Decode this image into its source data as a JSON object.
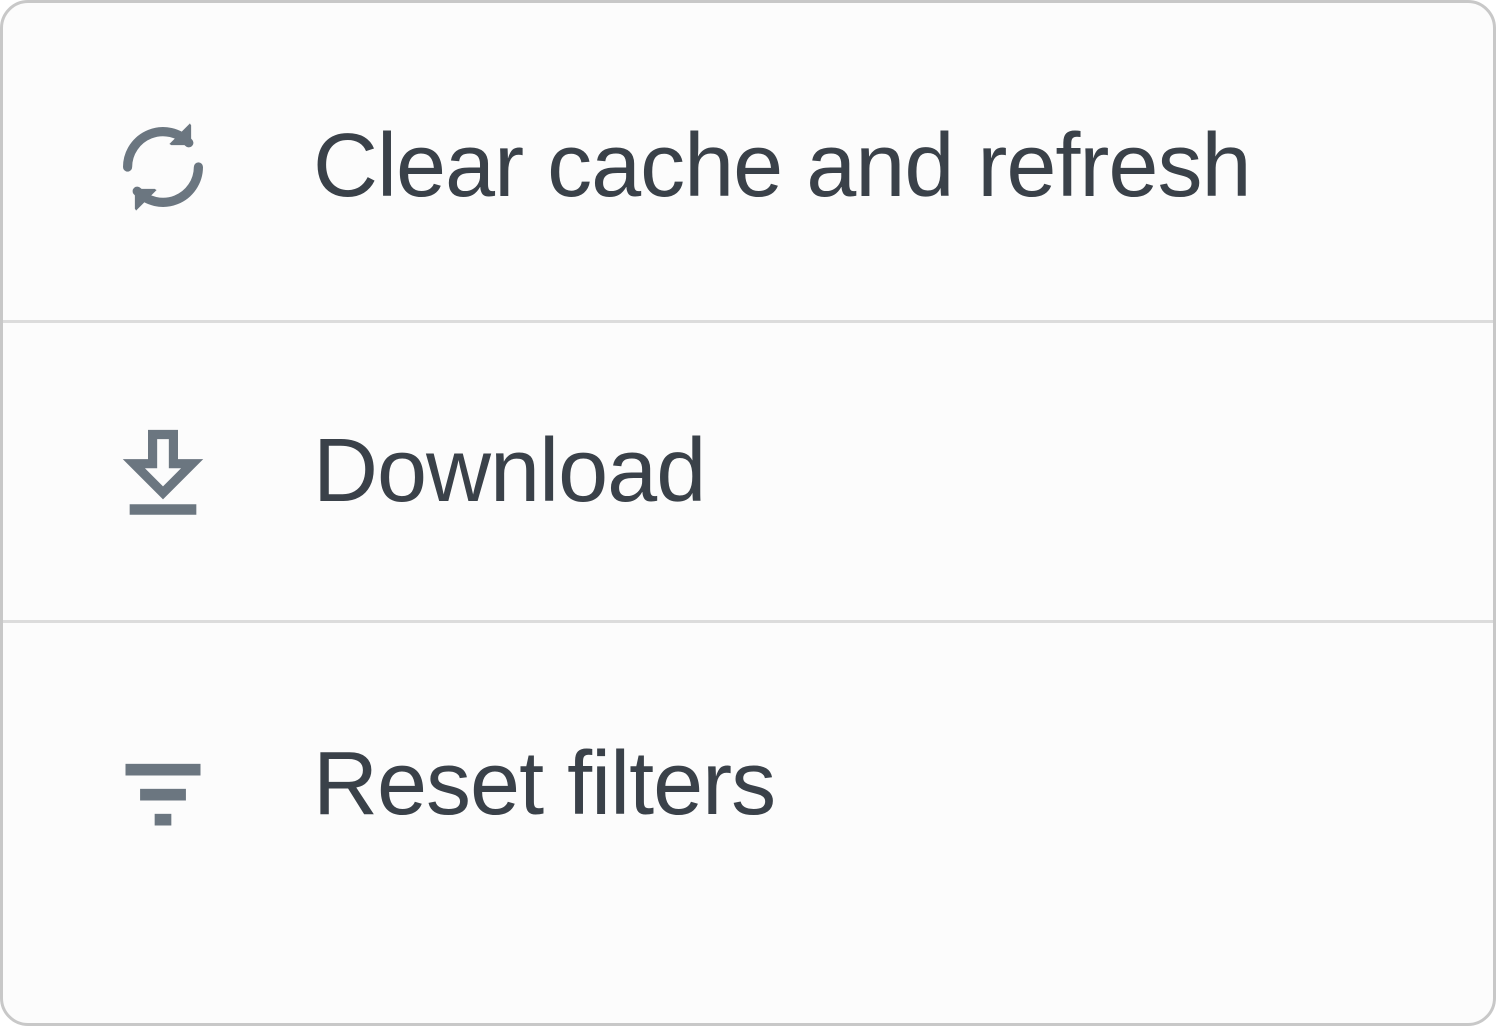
{
  "menu": {
    "items": [
      {
        "label": "Clear cache and refresh",
        "icon": "refresh-icon"
      },
      {
        "label": "Download",
        "icon": "download-icon"
      },
      {
        "label": "Reset filters",
        "icon": "filter-icon"
      }
    ]
  },
  "colors": {
    "text": "#3a4149",
    "icon": "#6b7680",
    "border": "#c8c8c8",
    "divider": "#dcdcdc",
    "background": "#fcfcfc"
  }
}
